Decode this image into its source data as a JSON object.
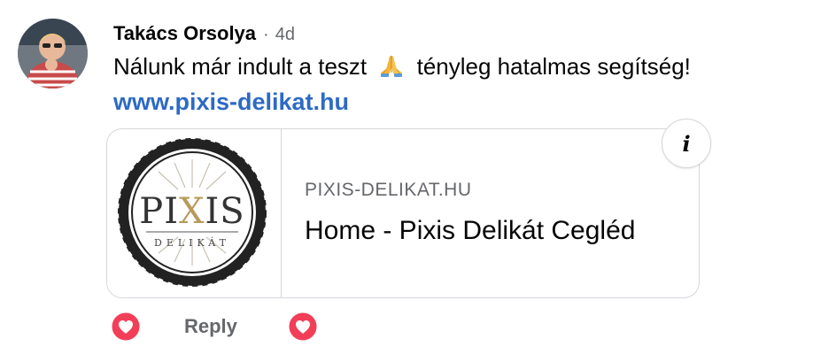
{
  "comment": {
    "author": "Takács Orsolya",
    "separator": "·",
    "time": "4d",
    "message_before": "Nálunk már indult a teszt",
    "emoji_icon": "folded-hands-emoji",
    "message_after": "tényleg hatalmas segítség!",
    "link_text": "www.pixis-delikat.hu"
  },
  "link_preview": {
    "logo_word": "PIXIS",
    "logo_subword": "DELIKÁT",
    "domain": "PIXIS-DELIKAT.HU",
    "title": "Home - Pixis Delikát Cegléd",
    "info_icon": "i"
  },
  "actions": {
    "reply_label": "Reply",
    "heart_color": "#f33e58"
  },
  "colors": {
    "link": "#2d6ac4",
    "secondary_text": "#65676b",
    "border": "#d5d7db",
    "logo_gold": "#b79a5b"
  }
}
